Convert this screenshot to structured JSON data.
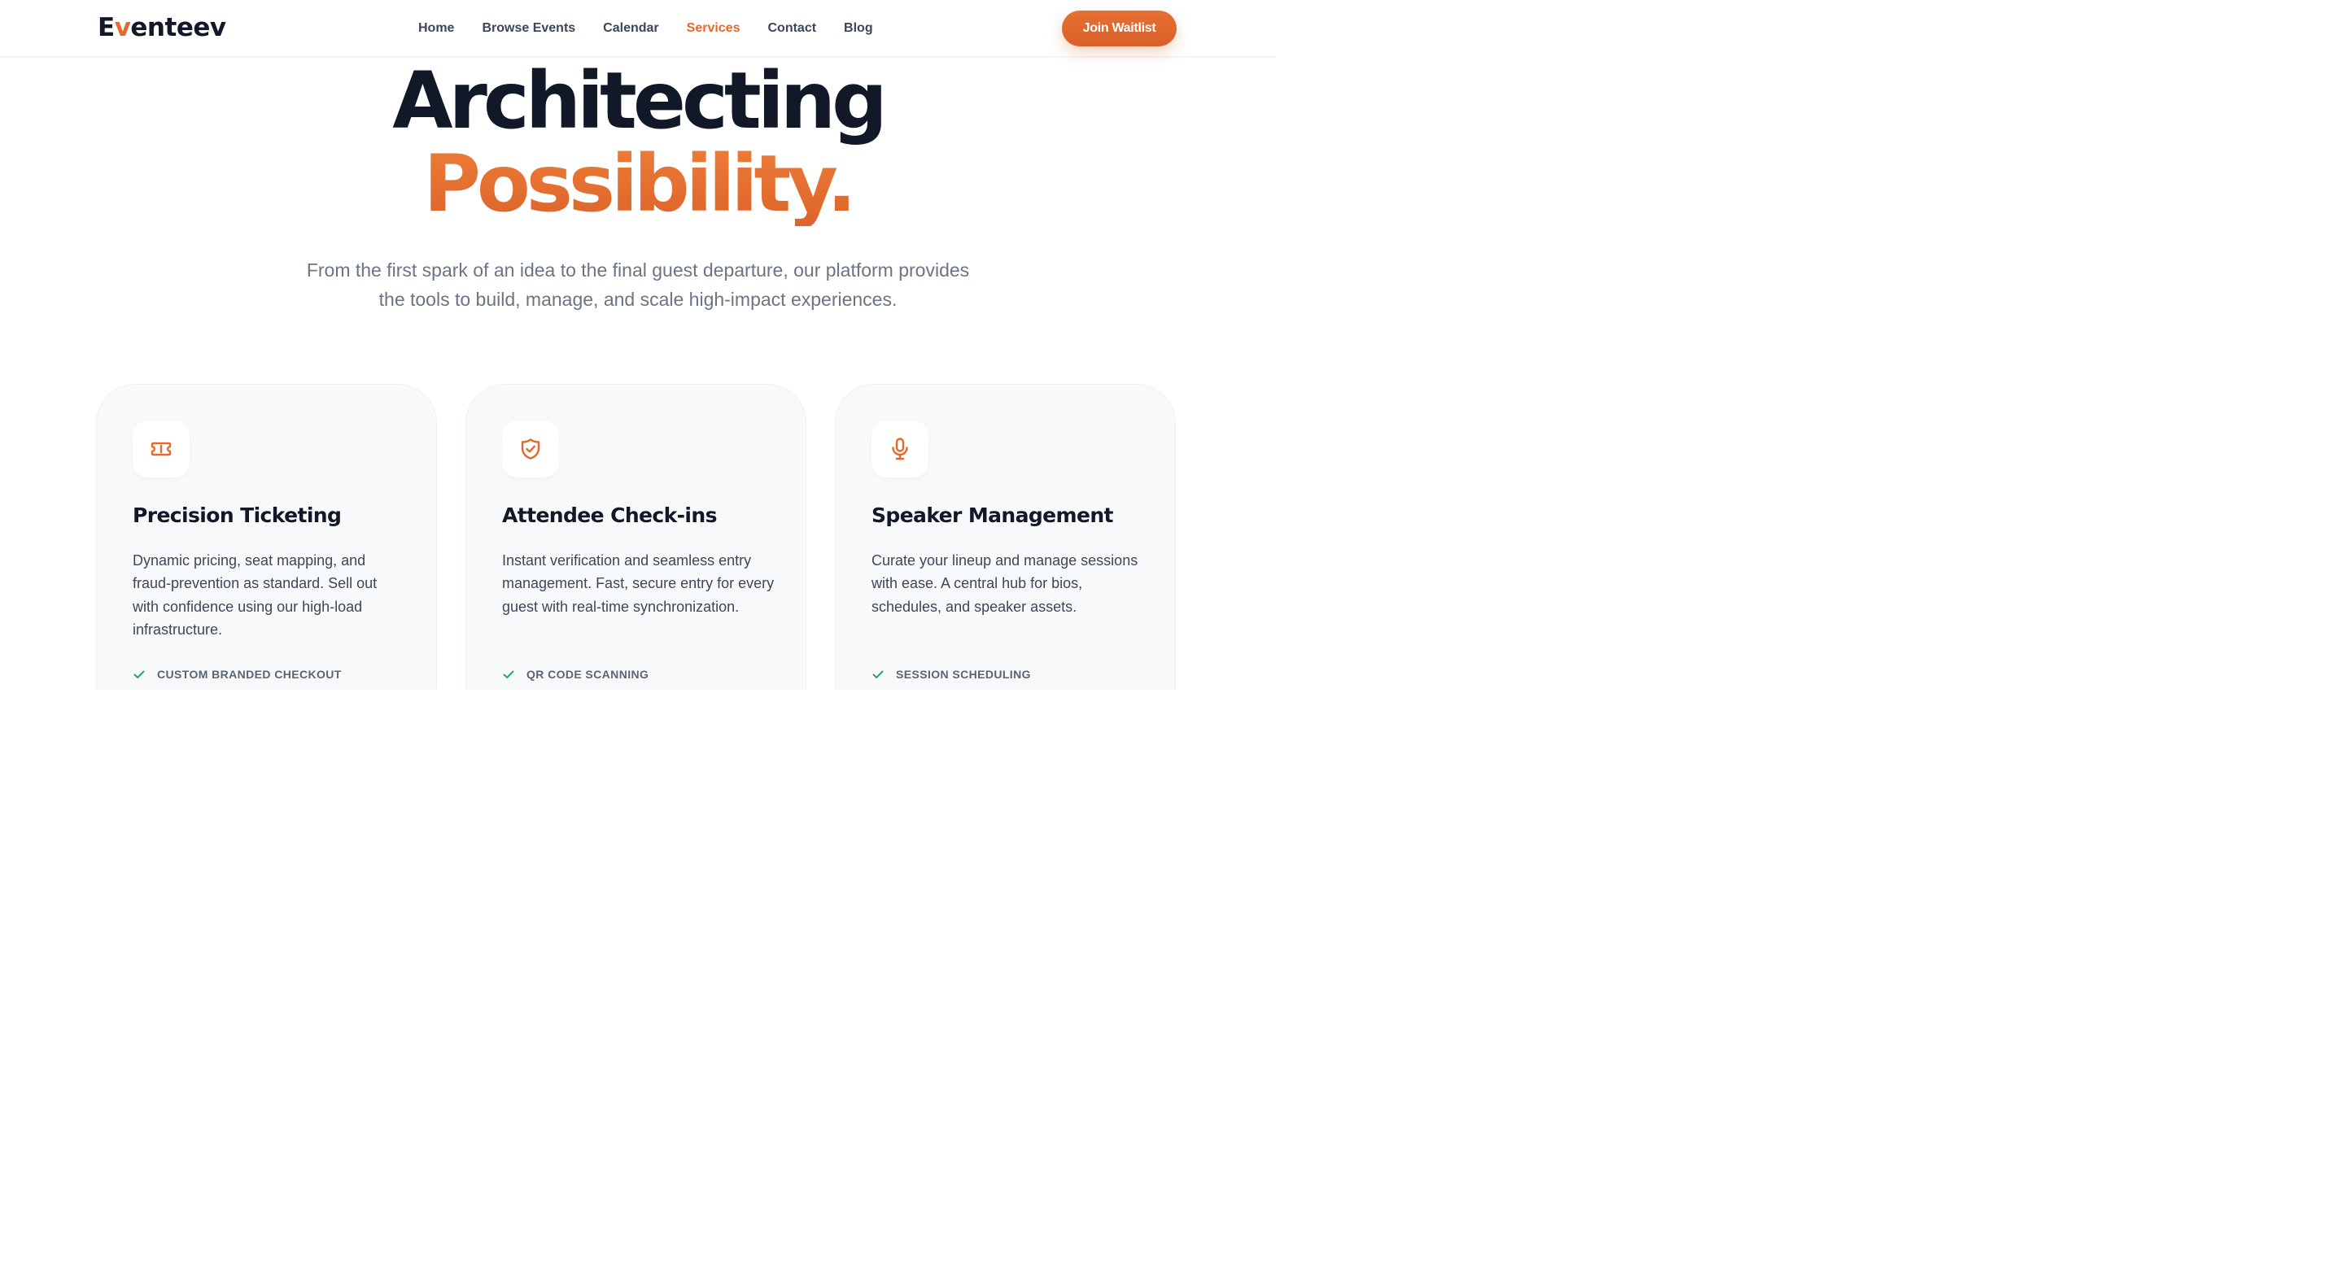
{
  "brand": {
    "logo_prefix": "E",
    "logo_accent": "v",
    "logo_suffix": "enteev",
    "accent_color": "#e4692c",
    "text_color": "#111827"
  },
  "nav": {
    "links": [
      {
        "label": "Home"
      },
      {
        "label": "Browse Events"
      },
      {
        "label": "Calendar"
      },
      {
        "label": "Services"
      },
      {
        "label": "Contact"
      },
      {
        "label": "Blog"
      }
    ],
    "active": "Services",
    "cta_label": "Join Waitlist"
  },
  "hero": {
    "title_line1": "Architecting",
    "title_line2": "Possibility.",
    "subtitle_line1": "From the first spark of an idea to the final guest departure, our platform provides",
    "subtitle_line2": "the tools to build, manage, and scale high-impact experiences."
  },
  "cards": [
    {
      "icon": "ticket-icon",
      "title": "Precision Ticketing",
      "description": "Dynamic pricing, seat mapping, and fraud-prevention as standard. Sell out with confidence using our high-load infrastructure.",
      "feature": "CUSTOM BRANDED CHECKOUT"
    },
    {
      "icon": "shield-check-icon",
      "title": "Attendee Check-ins",
      "description": "Instant verification and seamless entry management. Fast, secure entry for every guest with real-time synchronization.",
      "feature": "QR CODE SCANNING"
    },
    {
      "icon": "microphone-icon",
      "title": "Speaker Management",
      "description": "Curate your lineup and manage sessions with ease. A central hub for bios, schedules, and speaker assets.",
      "feature": "SESSION SCHEDULING"
    }
  ],
  "colors": {
    "check": "#2aa66a",
    "card_bg": "#f8f9fb"
  }
}
